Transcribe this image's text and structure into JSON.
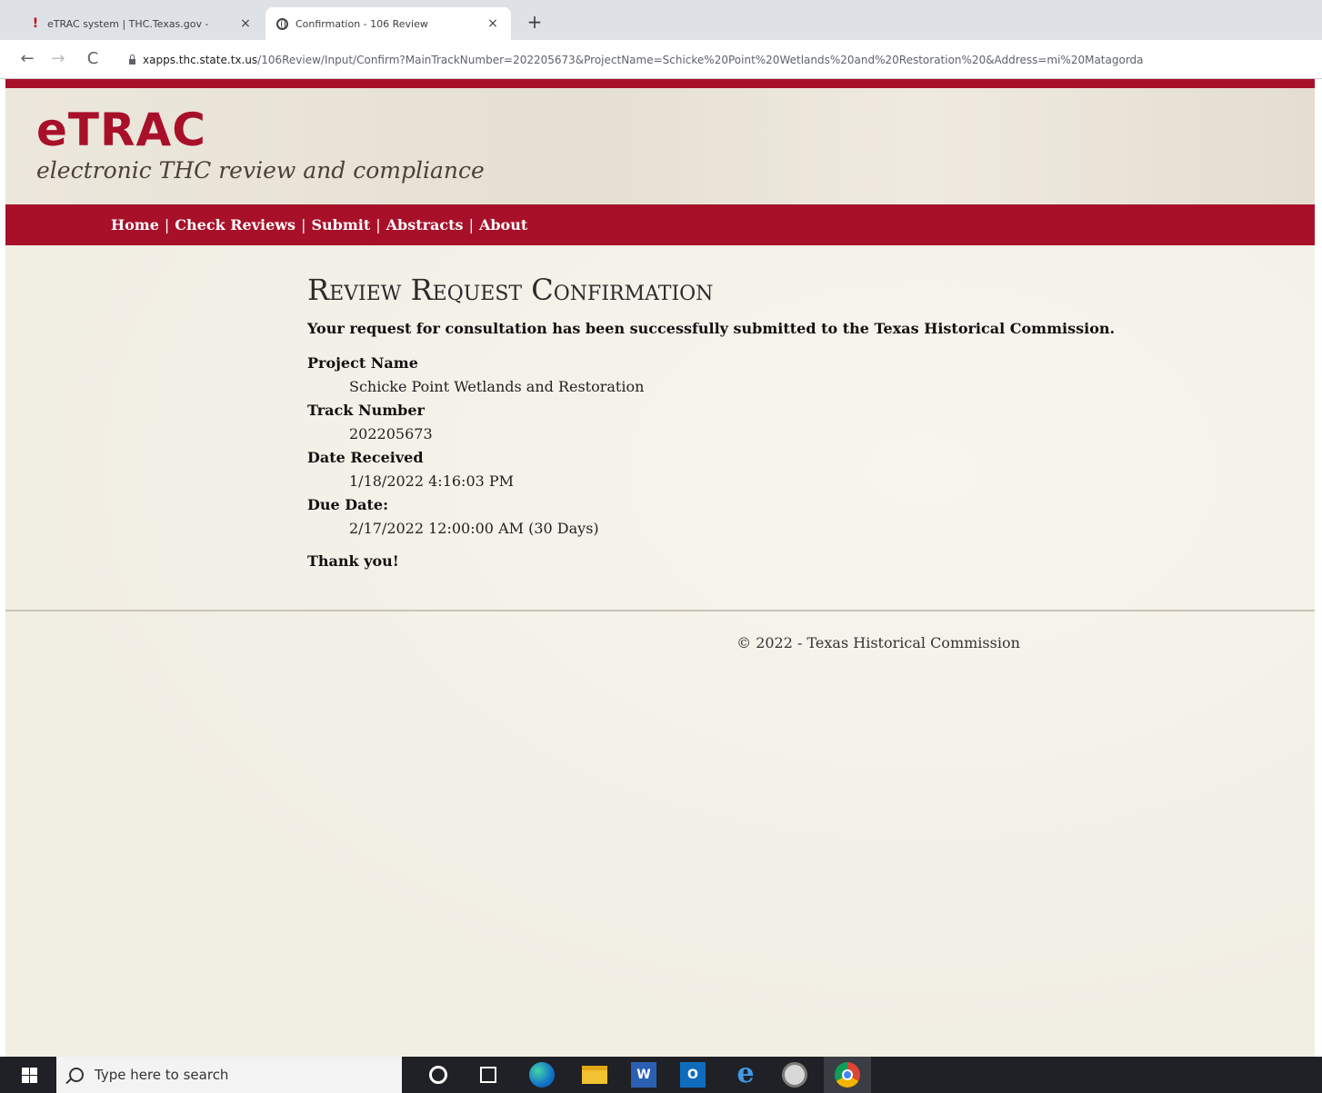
{
  "browser": {
    "tabs": [
      {
        "title": "eTRAC system | THC.Texas.gov -",
        "active": false,
        "favicon": "warning-icon"
      },
      {
        "title": "Confirmation - 106 Review",
        "active": true,
        "favicon": "globe-icon"
      }
    ],
    "close_glyph": "×",
    "new_tab_glyph": "+",
    "back_glyph": "←",
    "forward_glyph": "→",
    "reload_glyph": "C",
    "url_host": "xapps.thc.state.tx.us",
    "url_path": "/106Review/Input/Confirm?MainTrackNumber=202205673&ProjectName=Schicke%20Point%20Wetlands%20and%20Restoration%20&Address=mi%20Matagorda"
  },
  "site": {
    "logo": "eTRAC",
    "tagline": "electronic THC review and compliance",
    "brand_color": "#a8102a",
    "nav": [
      "Home",
      "Check Reviews",
      "Submit",
      "Abstracts",
      "About"
    ],
    "nav_separator": "|"
  },
  "confirmation": {
    "heading": "Review Request Confirmation",
    "lead": "Your request for consultation has been successfully submitted to the Texas Historical Commission.",
    "fields": [
      {
        "label": "Project Name",
        "value": "Schicke Point Wetlands and Restoration"
      },
      {
        "label": "Track Number",
        "value": "202205673"
      },
      {
        "label": "Date Received",
        "value": "1/18/2022 4:16:03 PM"
      },
      {
        "label": "Due Date:",
        "value": "2/17/2022 12:00:00 AM (30 Days)"
      }
    ],
    "thanks": "Thank you!"
  },
  "footer": {
    "text": "© 2022 - Texas Historical Commission"
  },
  "taskbar": {
    "search_placeholder": "Type here to search",
    "word_letter": "W",
    "outlook_letter": "O",
    "ie_letter": "e",
    "apps": [
      "cortana-icon",
      "task-view-icon",
      "edge-icon",
      "file-explorer-icon",
      "word-icon",
      "outlook-icon",
      "internet-explorer-icon",
      "app-icon",
      "chrome-icon"
    ]
  }
}
